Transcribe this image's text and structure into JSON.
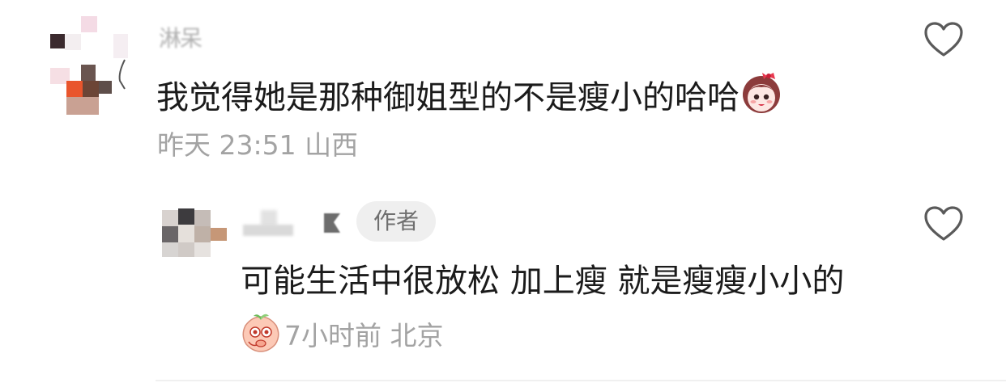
{
  "comment": {
    "username": "淋呆",
    "text": "我觉得她是那种御姐型的不是瘦小的哈哈",
    "emoji": "girl-face-emoji",
    "meta": "昨天 23:51 山西"
  },
  "reply": {
    "badge": "作者",
    "text": "可能生活中很放松 加上瘦 就是瘦瘦小小的",
    "emoji": "peach-face-emoji",
    "time": "7小时前 北京"
  },
  "colors": {
    "text": "#1b1b1b",
    "meta": "#a3a3a3",
    "badge_bg": "#efefef",
    "icon": "#5a5a5a"
  }
}
